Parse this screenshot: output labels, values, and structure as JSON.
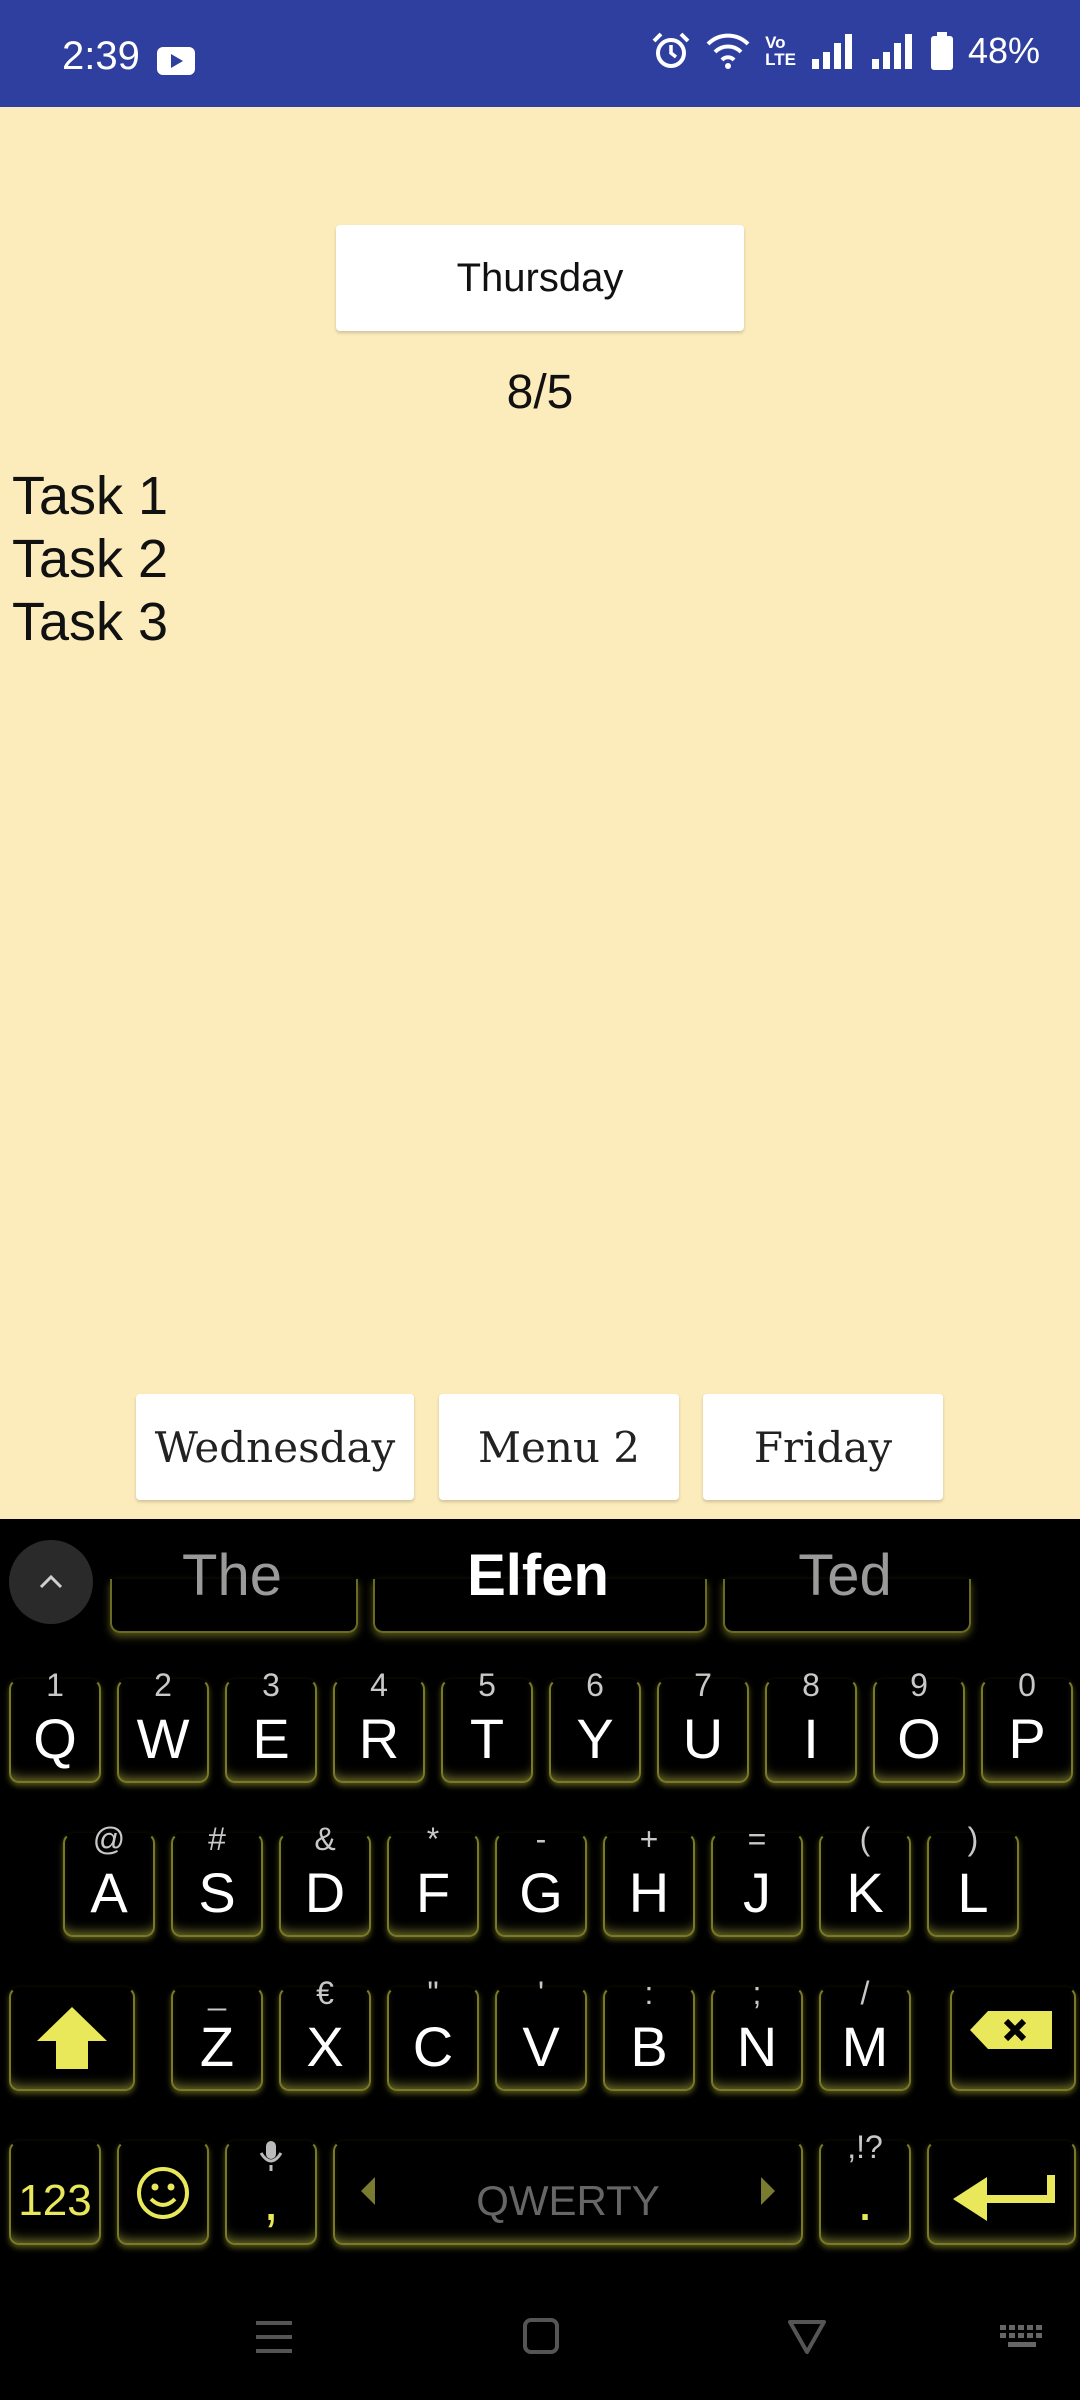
{
  "status_bar": {
    "time": "2:39",
    "battery": "48%",
    "volte_top": "Vo",
    "volte_bottom": "LTE",
    "icons": [
      "youtube-icon",
      "alarm-icon",
      "wifi-icon",
      "volte-icon",
      "signal-icon",
      "signal-icon",
      "battery-icon"
    ]
  },
  "app": {
    "day_button": "Thursday",
    "date": "8/5",
    "tasks": [
      "Task 1",
      "Task 2",
      "Task 3"
    ],
    "bottom_buttons": [
      "Wednesday",
      "Menu 2",
      "Friday"
    ]
  },
  "keyboard": {
    "suggestions": [
      "The",
      "Elfen",
      "Ted"
    ],
    "row1": [
      {
        "label": "Q",
        "hint": "1"
      },
      {
        "label": "W",
        "hint": "2"
      },
      {
        "label": "E",
        "hint": "3"
      },
      {
        "label": "R",
        "hint": "4"
      },
      {
        "label": "T",
        "hint": "5"
      },
      {
        "label": "Y",
        "hint": "6"
      },
      {
        "label": "U",
        "hint": "7"
      },
      {
        "label": "I",
        "hint": "8"
      },
      {
        "label": "O",
        "hint": "9"
      },
      {
        "label": "P",
        "hint": "0"
      }
    ],
    "row2": [
      {
        "label": "A",
        "hint": "@"
      },
      {
        "label": "S",
        "hint": "#"
      },
      {
        "label": "D",
        "hint": "&"
      },
      {
        "label": "F",
        "hint": "*"
      },
      {
        "label": "G",
        "hint": "-"
      },
      {
        "label": "H",
        "hint": "+"
      },
      {
        "label": "J",
        "hint": "="
      },
      {
        "label": "K",
        "hint": "("
      },
      {
        "label": "L",
        "hint": ")"
      }
    ],
    "row3": [
      {
        "label": "Z",
        "hint": "_"
      },
      {
        "label": "X",
        "hint": "€"
      },
      {
        "label": "C",
        "hint": "\""
      },
      {
        "label": "V",
        "hint": "'"
      },
      {
        "label": "B",
        "hint": ":"
      },
      {
        "label": "N",
        "hint": ";"
      },
      {
        "label": "M",
        "hint": "/"
      }
    ],
    "numbers_key": "123",
    "comma_key": ",",
    "space_label": "QWERTY",
    "period_key": ".",
    "period_hint": ",!?",
    "accent_color": "#e8e85a"
  }
}
